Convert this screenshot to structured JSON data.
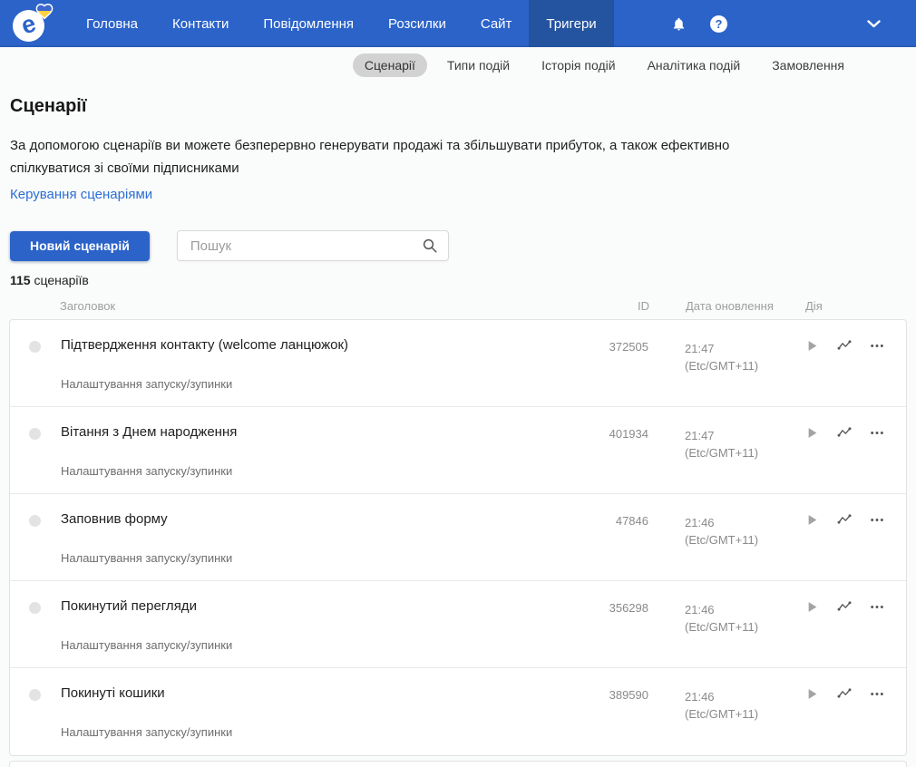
{
  "nav": {
    "items": [
      {
        "label": "Головна",
        "active": false
      },
      {
        "label": "Контакти",
        "active": false
      },
      {
        "label": "Повідомлення",
        "active": false
      },
      {
        "label": "Розсилки",
        "active": false
      },
      {
        "label": "Сайт",
        "active": false
      },
      {
        "label": "Тригери",
        "active": true
      }
    ],
    "logo_letter": "e",
    "help_glyph": "?"
  },
  "subnav": {
    "tabs": [
      {
        "label": "Сценарії",
        "active": true
      },
      {
        "label": "Типи подій",
        "active": false
      },
      {
        "label": "Історія подій",
        "active": false
      },
      {
        "label": "Аналітика подій",
        "active": false
      },
      {
        "label": "Замовлення",
        "active": false
      }
    ]
  },
  "page": {
    "title": "Сценарії",
    "description": "За допомогою сценаріїв ви можете безперервно генерувати продажі та збільшувати прибуток, а також ефективно спілкуватися зі своїми підписниками",
    "manage_link": "Керування сценаріями",
    "new_button": "Новий сценарій",
    "search_placeholder": "Пошук",
    "count_value": "115",
    "count_label": " сценаріїв"
  },
  "table": {
    "headers": {
      "title": "Заголовок",
      "id": "ID",
      "updated": "Дата оновлення",
      "action": "Дія"
    },
    "rows": [
      {
        "title": "Підтвердження контакту (welcome ланцюжок)",
        "id": "372505",
        "time": "21:47",
        "tz": "(Etc/GMT+11)",
        "subtext": "Налаштування запуску/зупинки"
      },
      {
        "title": "Вітання з Днем народження",
        "id": "401934",
        "time": "21:47",
        "tz": "(Etc/GMT+11)",
        "subtext": "Налаштування запуску/зупинки"
      },
      {
        "title": "Заповнив форму",
        "id": "47846",
        "time": "21:46",
        "tz": "(Etc/GMT+11)",
        "subtext": "Налаштування запуску/зупинки"
      },
      {
        "title": "Покинутий перегляди",
        "id": "356298",
        "time": "21:46",
        "tz": "(Etc/GMT+11)",
        "subtext": "Налаштування запуску/зупинки"
      },
      {
        "title": "Покинуті кошики",
        "id": "389590",
        "time": "21:46",
        "tz": "(Etc/GMT+11)",
        "subtext": "Налаштування запуску/зупинки"
      }
    ]
  },
  "colors": {
    "nav_bg": "#2b63c9",
    "nav_active": "#24539f",
    "accent": "#2b63c9",
    "link": "#2b6fd4",
    "tab_pill": "#d2d2d2",
    "heart_blue": "#3e68cf",
    "heart_yellow": "#ffd23e"
  }
}
